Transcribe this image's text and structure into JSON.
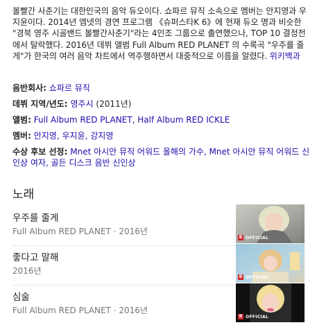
{
  "description": {
    "text": "볼빨간 사춘기는 대한민국의 음악 듀오이다. 쇼파르 뮤직 소속으로 멤버는 안지영과 우지윤이다. 2014년 엠넷의 경연 프로그램 《슈퍼스타K 6》에 현재 듀오 명과 비슷한 \"경북 영주 시골밴드 볼빨간사춘기\"라는 4인조 그룹으로 출연했으나, TOP 10 결정전에서 탈락했다. 2016년 데뷔 앨범 Full Album RED PLANET 의 수록곡 \"우주를 줄게\"가 한국의 여러 음악 차트에서 역주행하면서 대중적으로 이름을 알렸다.",
    "source_link": "위키백과"
  },
  "facts": {
    "label": {
      "label": "음반회사:",
      "value": "쇼파르 뮤직"
    },
    "origin": {
      "label": "데뷔 지역/년도:",
      "value": "영주시",
      "extra": "(2011년)"
    },
    "albums": {
      "label": "앨범:",
      "value1": "Full Album RED PLANET",
      "sep": ", ",
      "value2": "Half Album RED ICKLE"
    },
    "members": {
      "label": "멤버:",
      "value1": "안지영",
      "sep": ", ",
      "value2": "우지윤",
      "sep2": ", ",
      "value3": "강지영"
    },
    "awards": {
      "label": "수상 후보 선정:",
      "value1": "Mnet 아시안 뮤직 어워드 올해의 가수",
      "sep": ", ",
      "value2": "Mnet 아시안 뮤직 어워드 신인상 여자",
      "sep2": ", ",
      "value3": "골든 디스크 음반 신인상"
    }
  },
  "songs_heading": "노래",
  "songs": [
    {
      "title": "우주를 줄게",
      "subtitle": "Full Album RED PLANET · 2016년",
      "badge": "OFFICIAL",
      "badge_mark": "B"
    },
    {
      "title": "좋다고 말해",
      "subtitle": "2016년",
      "badge": "OFFICIAL",
      "badge_mark": "B"
    },
    {
      "title": "심술",
      "subtitle": "Full Album RED PLANET · 2016년",
      "badge": "OFFICIAL",
      "badge_mark": "B"
    }
  ],
  "colors": {
    "link": "#1a0dab",
    "text": "#222222",
    "muted": "#70757a"
  }
}
